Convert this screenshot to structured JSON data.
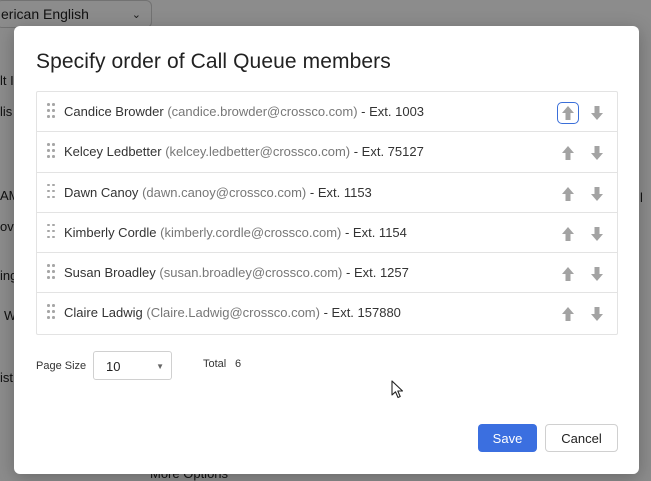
{
  "background": {
    "language_select": "erican English",
    "fragments": [
      "lt I",
      "lis",
      "AM",
      "ov",
      "ing",
      "W",
      "ist",
      "l",
      "More Options"
    ]
  },
  "modal": {
    "title": "Specify order of Call Queue members",
    "members": [
      {
        "name": "Candice Browder",
        "email": "(candice.browder@crossco.com)",
        "ext": " - Ext. 1003",
        "up_focused": true
      },
      {
        "name": "Kelcey Ledbetter",
        "email": "(kelcey.ledbetter@crossco.com)",
        "ext": " - Ext. 75127",
        "up_focused": false
      },
      {
        "name": "Dawn Canoy",
        "email": "(dawn.canoy@crossco.com)",
        "ext": " - Ext. 1153",
        "up_focused": false
      },
      {
        "name": "Kimberly Cordle",
        "email": "(kimberly.cordle@crossco.com)",
        "ext": " - Ext. 1154",
        "up_focused": false
      },
      {
        "name": "Susan Broadley",
        "email": "(susan.broadley@crossco.com)",
        "ext": " - Ext. 1257",
        "up_focused": false
      },
      {
        "name": "Claire Ladwig",
        "email": "(Claire.Ladwig@crossco.com)",
        "ext": " - Ext. 157880",
        "up_focused": false
      }
    ],
    "page_size_label": "Page Size",
    "page_size_value": "10",
    "total_label": "Total",
    "total_value": "6",
    "save_label": "Save",
    "cancel_label": "Cancel"
  },
  "icons": {
    "drag": "drag-handle-icon",
    "up": "arrow-up-icon",
    "down": "arrow-down-icon",
    "cursor": "mouse-pointer-icon"
  },
  "colors": {
    "primary": "#3b6fe0",
    "arrow": "#a3a3a3",
    "email_text": "#777777"
  }
}
